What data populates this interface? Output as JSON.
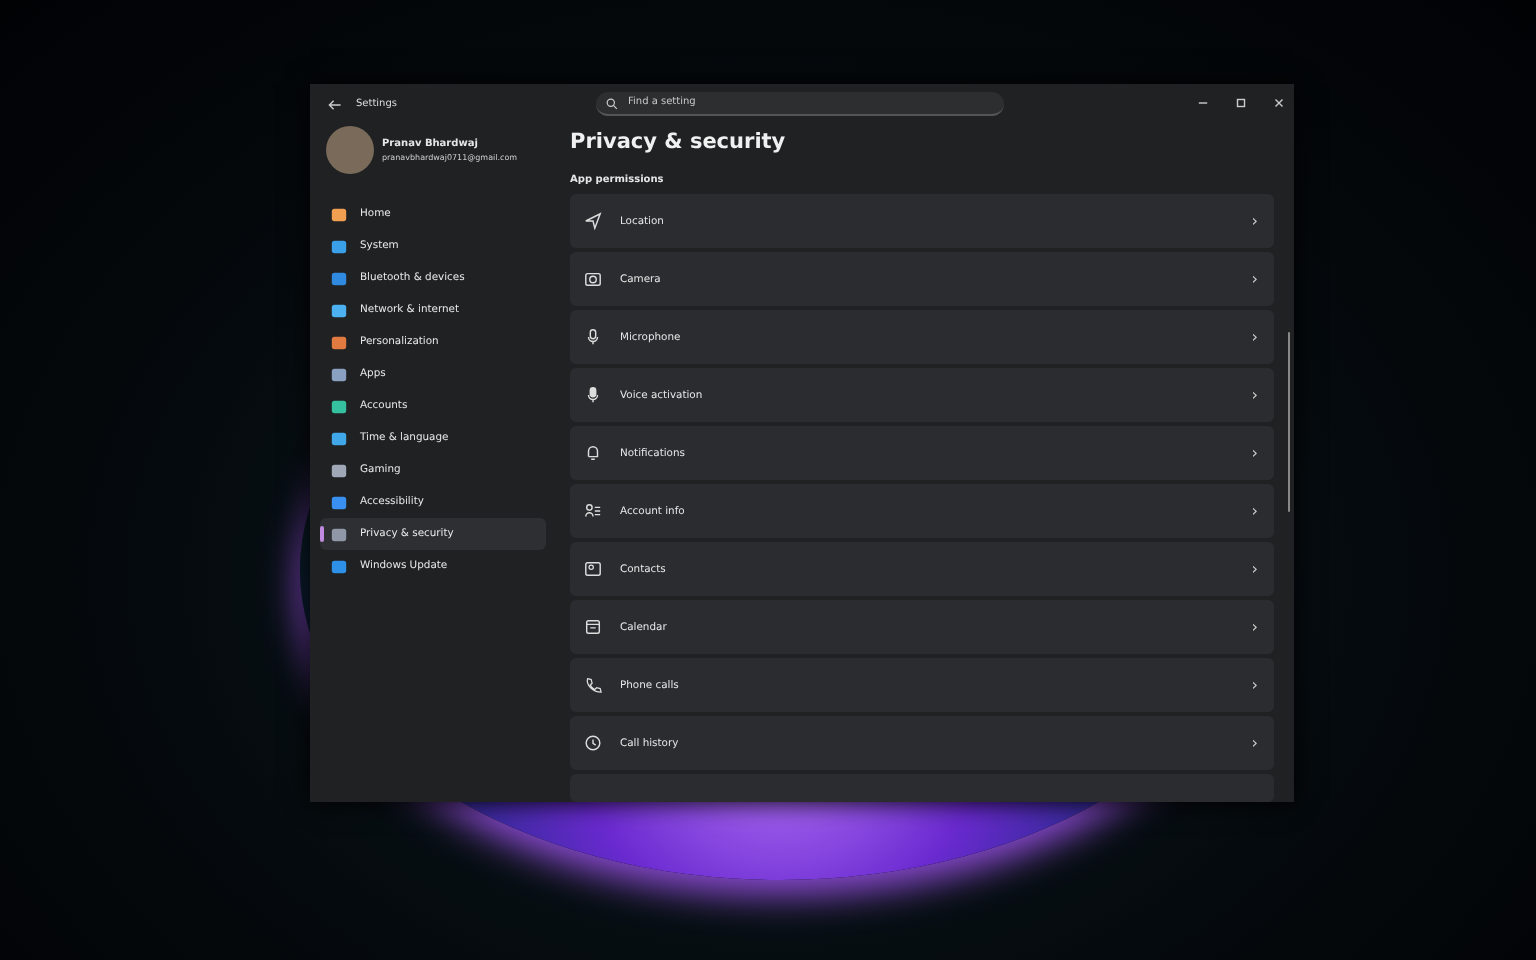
{
  "window": {
    "title": "Settings",
    "search": {
      "placeholder": "Find a setting"
    }
  },
  "profile": {
    "name": "Pranav Bhardwaj",
    "email": "pranavbhardwaj0711@gmail.com"
  },
  "sidebar": {
    "items": [
      {
        "label": "Home",
        "selected": false
      },
      {
        "label": "System",
        "selected": false
      },
      {
        "label": "Bluetooth & devices",
        "selected": false
      },
      {
        "label": "Network & internet",
        "selected": false
      },
      {
        "label": "Personalization",
        "selected": false
      },
      {
        "label": "Apps",
        "selected": false
      },
      {
        "label": "Accounts",
        "selected": false
      },
      {
        "label": "Time & language",
        "selected": false
      },
      {
        "label": "Gaming",
        "selected": false
      },
      {
        "label": "Accessibility",
        "selected": false
      },
      {
        "label": "Privacy & security",
        "selected": true
      },
      {
        "label": "Windows Update",
        "selected": false
      }
    ]
  },
  "page": {
    "title": "Privacy & security",
    "section": "App permissions",
    "items": [
      {
        "label": "Location",
        "chevron": "›"
      },
      {
        "label": "Camera",
        "chevron": "›"
      },
      {
        "label": "Microphone",
        "chevron": "›"
      },
      {
        "label": "Voice activation",
        "chevron": "›"
      },
      {
        "label": "Notifications",
        "chevron": "›"
      },
      {
        "label": "Account info",
        "chevron": "›"
      },
      {
        "label": "Contacts",
        "chevron": "›"
      },
      {
        "label": "Calendar",
        "chevron": "›"
      },
      {
        "label": "Phone calls",
        "chevron": "›"
      },
      {
        "label": "Call history",
        "chevron": "›"
      }
    ]
  }
}
